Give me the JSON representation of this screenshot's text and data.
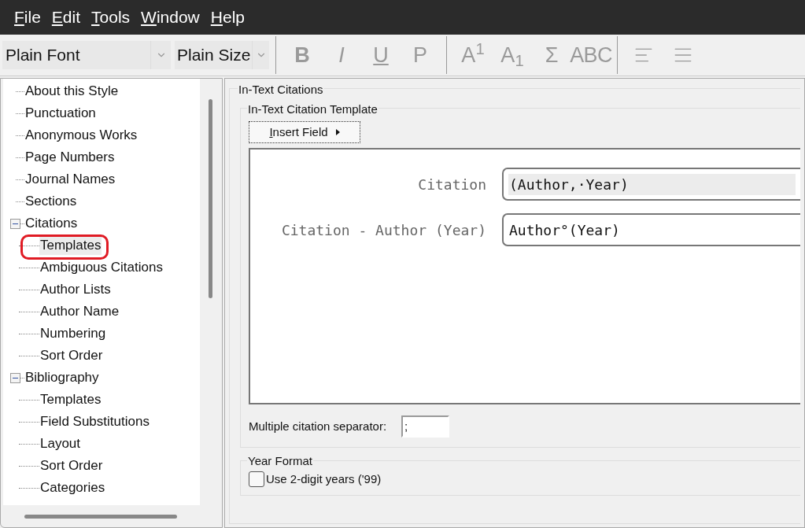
{
  "menu": [
    "File",
    "Edit",
    "Tools",
    "Window",
    "Help"
  ],
  "toolbar": {
    "font": "Plain Font",
    "size": "Plain Size",
    "buttons": [
      {
        "kind": "text",
        "label": "B"
      },
      {
        "kind": "text",
        "label": "I"
      },
      {
        "kind": "text",
        "label": "U"
      },
      {
        "kind": "text",
        "label": "P"
      },
      {
        "kind": "text",
        "label": "A$^{1}$"
      },
      {
        "kind": "text",
        "label": "A$_{1}$"
      },
      {
        "kind": "text",
        "label": "Σ"
      },
      {
        "kind": "text",
        "label": "ABC"
      },
      {
        "kind": "align-left"
      },
      {
        "kind": "justify"
      }
    ]
  },
  "tree": [
    {
      "label": "About this Style",
      "selected": false
    },
    {
      "label": "Punctuation",
      "selected": false
    },
    {
      "label": "Anonymous Works",
      "selected": false
    },
    {
      "label": "Page Numbers",
      "selected": false
    },
    {
      "label": "Journal Names",
      "selected": false
    },
    {
      "label": "Sections",
      "selected": false
    },
    {
      "label": "Citations",
      "selected": false,
      "expanded": true,
      "children": [
        {
          "label": "Templates",
          "selected": true
        },
        {
          "label": "Ambiguous Citations",
          "selected": false
        },
        {
          "label": "Author Lists",
          "selected": false
        },
        {
          "label": "Author Name",
          "selected": false
        },
        {
          "label": "Numbering",
          "selected": false
        },
        {
          "label": "Sort Order",
          "selected": false
        }
      ]
    },
    {
      "label": "Bibliography",
      "selected": false,
      "expanded": true,
      "children": [
        {
          "label": "Templates",
          "selected": false
        },
        {
          "label": "Field Substitutions",
          "selected": false
        },
        {
          "label": "Layout",
          "selected": false
        },
        {
          "label": "Sort Order",
          "selected": false
        },
        {
          "label": "Categories",
          "selected": false
        }
      ]
    }
  ],
  "section": {
    "title": "In-Text Citations",
    "template_group": {
      "title": "In-Text Citation Template",
      "insert_field": "Insert Field",
      "fields": [
        {
          "label": "Citation",
          "value": "(Author,·Year)",
          "focused": true
        },
        {
          "label": "Citation - Author (Year)",
          "value": "Author°(Year)",
          "focused": false
        }
      ],
      "separator_label": "Multiple citation separator:",
      "separator_value": ";"
    },
    "year_group": {
      "title": "Year Format",
      "checkbox": {
        "label": "Use 2-digit years ('99)",
        "checked": false
      }
    }
  }
}
